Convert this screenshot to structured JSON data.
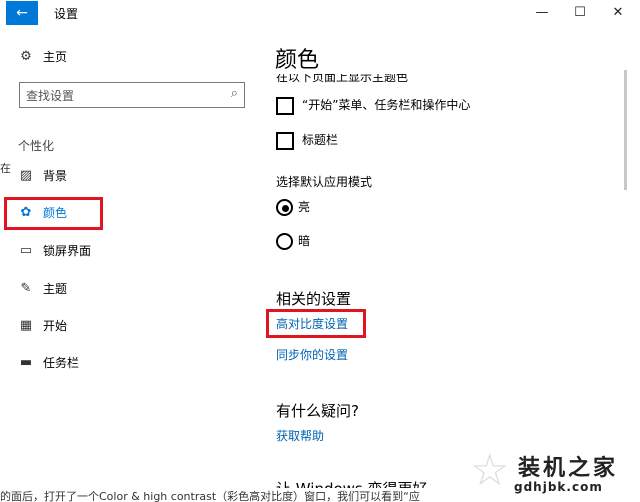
{
  "window": {
    "title": "设置",
    "back_icon": "back-arrow-icon",
    "controls": {
      "minimize": "—",
      "maximize": "☐",
      "close": "✕"
    }
  },
  "sidebar": {
    "home_label": "主页",
    "search_placeholder": "查找设置",
    "section_label": "个性化",
    "items": [
      {
        "label": "背景",
        "icon": "picture-icon"
      },
      {
        "label": "颜色",
        "icon": "palette-icon"
      },
      {
        "label": "锁屏界面",
        "icon": "lockscreen-icon"
      },
      {
        "label": "主题",
        "icon": "theme-icon"
      },
      {
        "label": "开始",
        "icon": "start-icon"
      },
      {
        "label": "任务栏",
        "icon": "taskbar-icon"
      }
    ]
  },
  "main": {
    "title": "颜色",
    "cutoff_text": "在以下页面上显示主题色",
    "checkboxes": [
      {
        "label": "“开始”菜单、任务栏和操作中心",
        "checked": false
      },
      {
        "label": "标题栏",
        "checked": false
      }
    ],
    "app_mode_label": "选择默认应用模式",
    "app_modes": [
      {
        "label": "亮",
        "selected": true
      },
      {
        "label": "暗",
        "selected": false
      }
    ],
    "related_heading": "相关的设置",
    "related_links": [
      "高对比度设置",
      "同步你的设置"
    ],
    "question_heading": "有什么疑问?",
    "help_link": "获取帮助",
    "better_heading": "让 Windows 变得更好"
  },
  "overlay": {
    "bottom_text": "的面后，打开了一个Color & high contrast（彩色高对比度）窗口，我们可以看到“应",
    "left_edge_text": "在",
    "watermark_title": "装机之家",
    "watermark_url": "gdhjbk.com"
  },
  "colors": {
    "accent": "#0078d7",
    "highlight": "#e0151f",
    "link": "#0063b1"
  }
}
